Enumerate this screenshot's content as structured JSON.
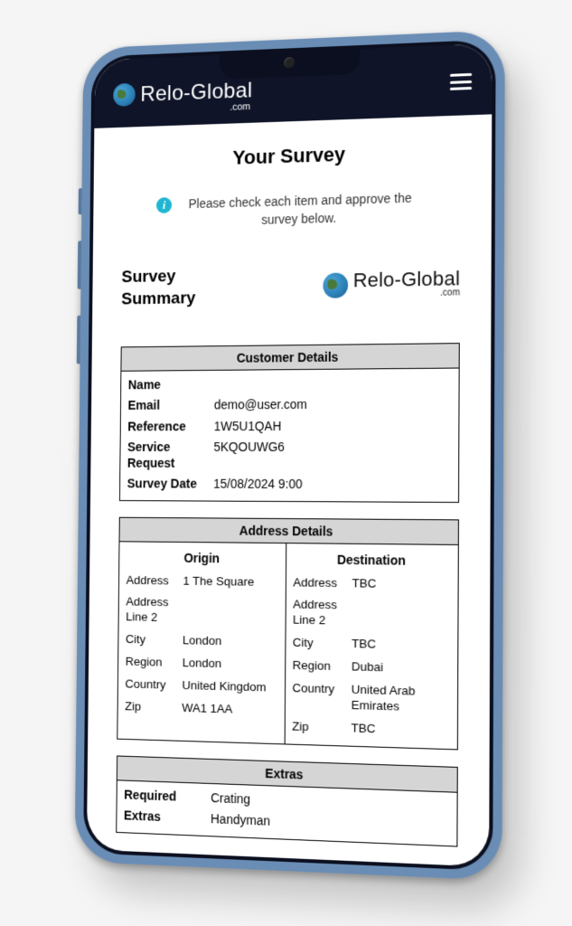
{
  "header": {
    "brand_main": "Relo-Global",
    "brand_sub": ".com"
  },
  "page": {
    "title": "Your Survey",
    "info_text": "Please check each item and approve the survey below."
  },
  "summary": {
    "heading_line1": "Survey",
    "heading_line2": "Summary",
    "brand_main": "Relo-Global",
    "brand_sub": ".com"
  },
  "customer_section": {
    "title": "Customer Details",
    "rows": [
      {
        "label": "Name",
        "value": ""
      },
      {
        "label": "Email",
        "value": "demo@user.com"
      },
      {
        "label": "Reference",
        "value": "1W5U1QAH"
      },
      {
        "label": "Service Request",
        "value": "5KQOUWG6"
      },
      {
        "label": "Survey Date",
        "value": "15/08/2024 9:00"
      }
    ]
  },
  "address_section": {
    "title": "Address Details",
    "origin": {
      "heading": "Origin",
      "rows": [
        {
          "label": "Address",
          "value": "1 The Square"
        },
        {
          "label": "Address Line 2",
          "value": ""
        },
        {
          "label": "City",
          "value": "London"
        },
        {
          "label": "Region",
          "value": "London"
        },
        {
          "label": "Country",
          "value": "United Kingdom"
        },
        {
          "label": "Zip",
          "value": "WA1 1AA"
        }
      ]
    },
    "destination": {
      "heading": "Destination",
      "rows": [
        {
          "label": "Address",
          "value": "TBC"
        },
        {
          "label": "Address Line 2",
          "value": ""
        },
        {
          "label": "City",
          "value": "TBC"
        },
        {
          "label": "Region",
          "value": "Dubai"
        },
        {
          "label": "Country",
          "value": "United Arab Emirates"
        },
        {
          "label": "Zip",
          "value": "TBC"
        }
      ]
    }
  },
  "extras_section": {
    "title": "Extras",
    "rows": [
      {
        "label": "Required",
        "value": "Crating"
      },
      {
        "label": "Extras",
        "value": "Handyman"
      }
    ]
  }
}
